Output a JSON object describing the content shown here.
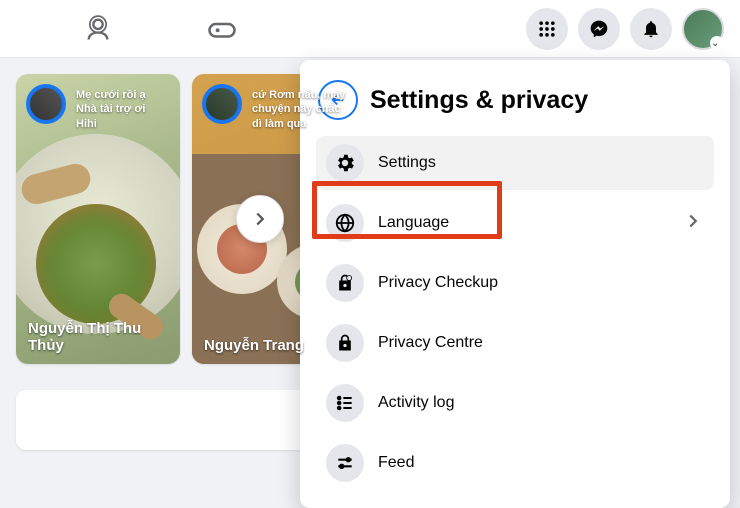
{
  "topbar": {
    "nav": {
      "friends_icon": "friends-icon",
      "gaming_icon": "gaming-icon"
    },
    "right": {
      "menu_icon": "grid-menu-icon",
      "messenger_icon": "messenger-icon",
      "notifications_icon": "bell-icon",
      "profile_icon": "avatar"
    }
  },
  "stories": [
    {
      "overlay_text": "Mẹ cưới rồi ạ\nNhà tài trợ ơi\nHihi",
      "name": "Nguyễn Thị Thu Thủy"
    },
    {
      "overlay_text": "cứ Rơm nấu, máy chuyện này chắc dì làm qua",
      "name": "Nguyễn Trang"
    }
  ],
  "dropdown": {
    "title": "Settings & privacy",
    "items": [
      {
        "icon": "gear-icon",
        "label": "Settings",
        "has_chevron": false,
        "hover": true
      },
      {
        "icon": "globe-icon",
        "label": "Language",
        "has_chevron": true,
        "hover": false
      },
      {
        "icon": "lock-heart-icon",
        "label": "Privacy Checkup",
        "has_chevron": false,
        "hover": false
      },
      {
        "icon": "lock-icon",
        "label": "Privacy Centre",
        "has_chevron": false,
        "hover": false
      },
      {
        "icon": "list-icon",
        "label": "Activity log",
        "has_chevron": false,
        "hover": false
      },
      {
        "icon": "sliders-icon",
        "label": "Feed",
        "has_chevron": false,
        "hover": false
      }
    ]
  },
  "highlight": {
    "target": "Settings"
  }
}
